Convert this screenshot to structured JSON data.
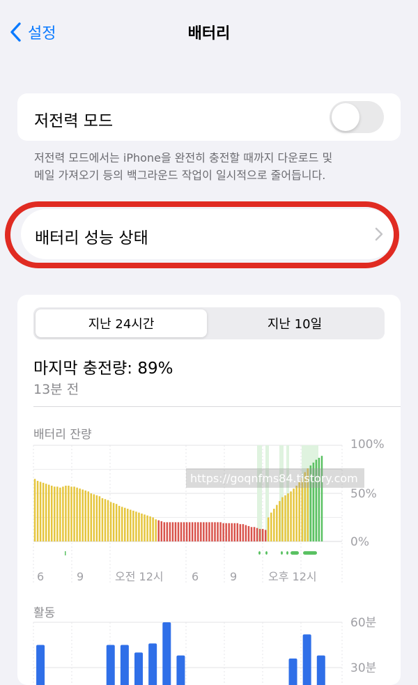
{
  "nav": {
    "back_label": "설정",
    "title": "배터리"
  },
  "low_power": {
    "label": "저전력 모드",
    "enabled": false,
    "description_line1": "저전력 모드에서는 iPhone을 완전히 충전할 때까지 다운로드 및",
    "description_line2": "메일 가져오기 등의 백그라운드 작업이 일시적으로 줄어듭니다."
  },
  "health": {
    "label": "배터리 성능 상태"
  },
  "segments": {
    "last24": "지난 24시간",
    "last10": "지난 10일",
    "selected": "last24"
  },
  "summary": {
    "last_charge": "마지막 충전량: 89%",
    "ago": "13분 전"
  },
  "watermark": "https://goqnfms84.tistory.com",
  "colors": {
    "accent": "#0a7aff",
    "highlight": "#e02b22",
    "yellow": "#e5c53c",
    "red": "#d9534b",
    "green": "#5ac162",
    "blue": "#2f6fe8"
  },
  "chart_data": [
    {
      "type": "bar",
      "title": "배터리 잔량",
      "y_ticks": [
        "100%",
        "50%",
        "0%"
      ],
      "ylim": [
        0,
        100
      ],
      "x_ticks": [
        "6",
        "9",
        "오전 12시",
        "6",
        "9",
        "오후 12시"
      ],
      "values": [
        65,
        63,
        62,
        61,
        60,
        59,
        58,
        57,
        57,
        56,
        57,
        58,
        58,
        57,
        57,
        56,
        55,
        54,
        53,
        52,
        50,
        49,
        48,
        47,
        45,
        44,
        43,
        41,
        40,
        39,
        37,
        36,
        35,
        34,
        33,
        32,
        31,
        30,
        29,
        28,
        27,
        26,
        25,
        23,
        22,
        21,
        20,
        20,
        20,
        20,
        20,
        20,
        20,
        20,
        20,
        20,
        20,
        20,
        20,
        20,
        20,
        20,
        20,
        20,
        20,
        20,
        20,
        19,
        19,
        19,
        19,
        19,
        19,
        18,
        18,
        17,
        16,
        15,
        15,
        14,
        13,
        13,
        12,
        25,
        30,
        34,
        38,
        42,
        46,
        48,
        50,
        52,
        55,
        58,
        62,
        66,
        72,
        76,
        79,
        82,
        85,
        87,
        89
      ],
      "state": [
        "Y",
        "Y",
        "Y",
        "Y",
        "Y",
        "Y",
        "Y",
        "Y",
        "Y",
        "Y",
        "Y",
        "Y",
        "Y",
        "Y",
        "Y",
        "Y",
        "Y",
        "Y",
        "Y",
        "Y",
        "Y",
        "Y",
        "Y",
        "Y",
        "Y",
        "Y",
        "Y",
        "Y",
        "Y",
        "Y",
        "Y",
        "Y",
        "Y",
        "Y",
        "Y",
        "Y",
        "Y",
        "Y",
        "Y",
        "Y",
        "Y",
        "Y",
        "Y",
        "Y",
        "R",
        "R",
        "R",
        "R",
        "R",
        "R",
        "R",
        "R",
        "R",
        "R",
        "R",
        "R",
        "R",
        "R",
        "R",
        "R",
        "R",
        "R",
        "R",
        "R",
        "R",
        "R",
        "R",
        "R",
        "R",
        "R",
        "R",
        "R",
        "R",
        "R",
        "R",
        "R",
        "R",
        "R",
        "R",
        "R",
        "R",
        "R",
        "R",
        "Y",
        "Y",
        "Y",
        "Y",
        "Y",
        "Y",
        "Y",
        "Y",
        "Y",
        "Y",
        "Y",
        "Y",
        "Y",
        "Y",
        "Y",
        "G",
        "G",
        "G",
        "G",
        "G",
        "G",
        "G"
      ]
    },
    {
      "type": "bar",
      "title": "활동",
      "y_ticks": [
        "60분",
        "30분"
      ],
      "ylim": [
        0,
        60
      ],
      "values": [
        45,
        0,
        0,
        0,
        0,
        45,
        45,
        40,
        46,
        60,
        38,
        0,
        0,
        0,
        0,
        0,
        0,
        0,
        36,
        52,
        38,
        0
      ]
    }
  ]
}
